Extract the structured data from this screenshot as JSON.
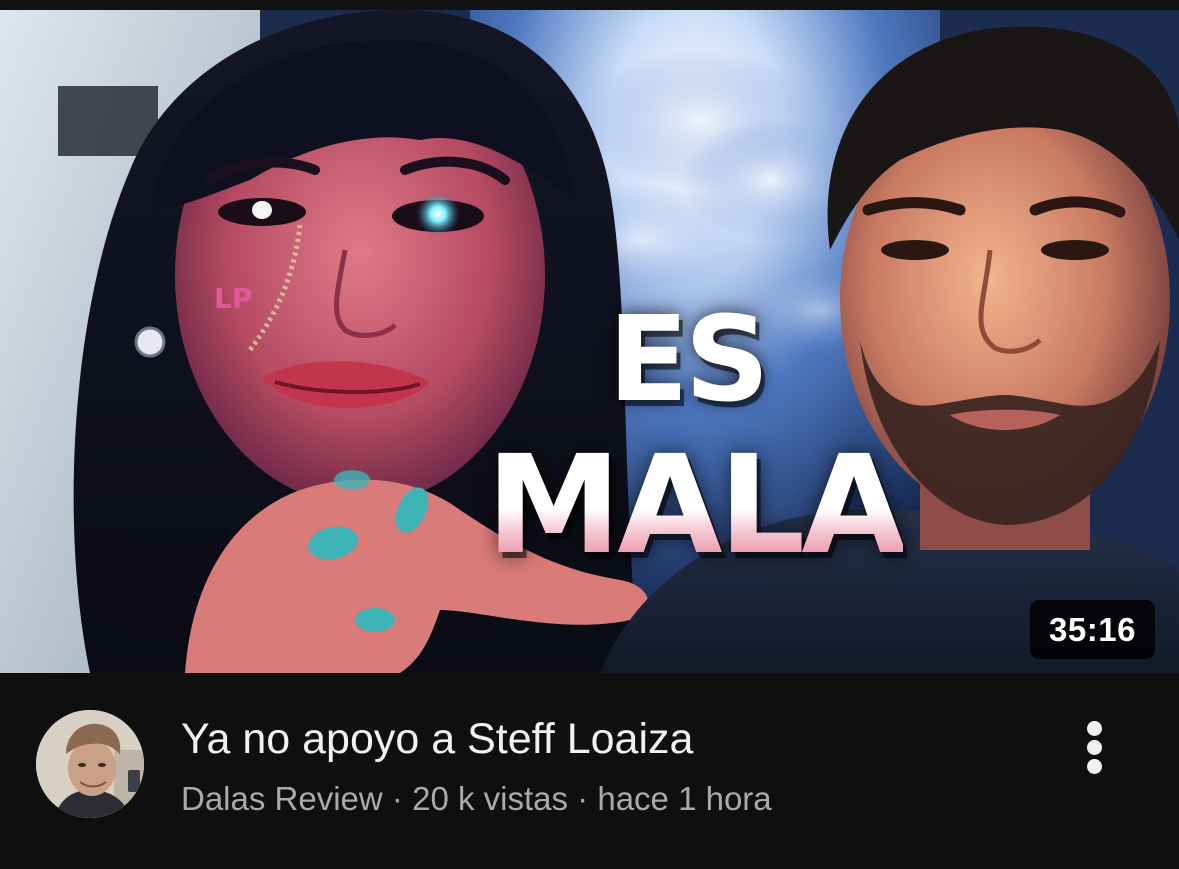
{
  "video": {
    "thumbnail": {
      "overlay_line1": "ES",
      "overlay_line2": "MALA",
      "duration": "35:16"
    },
    "title": "Ya no apoyo a Steff Loaiza",
    "channel": "Dalas Review",
    "separator": "·",
    "views": "20 k vistas",
    "age": "hace 1 hora"
  },
  "icons": {
    "more_menu": "more-vertical-icon"
  },
  "colors": {
    "background": "#0f0f0f",
    "title_text": "#f1f1f1",
    "secondary_text": "#aaaaaa",
    "overlay_text": "#ffffff",
    "overlay_gradient_accent": "#e4788f",
    "badge_background": "#000000"
  }
}
